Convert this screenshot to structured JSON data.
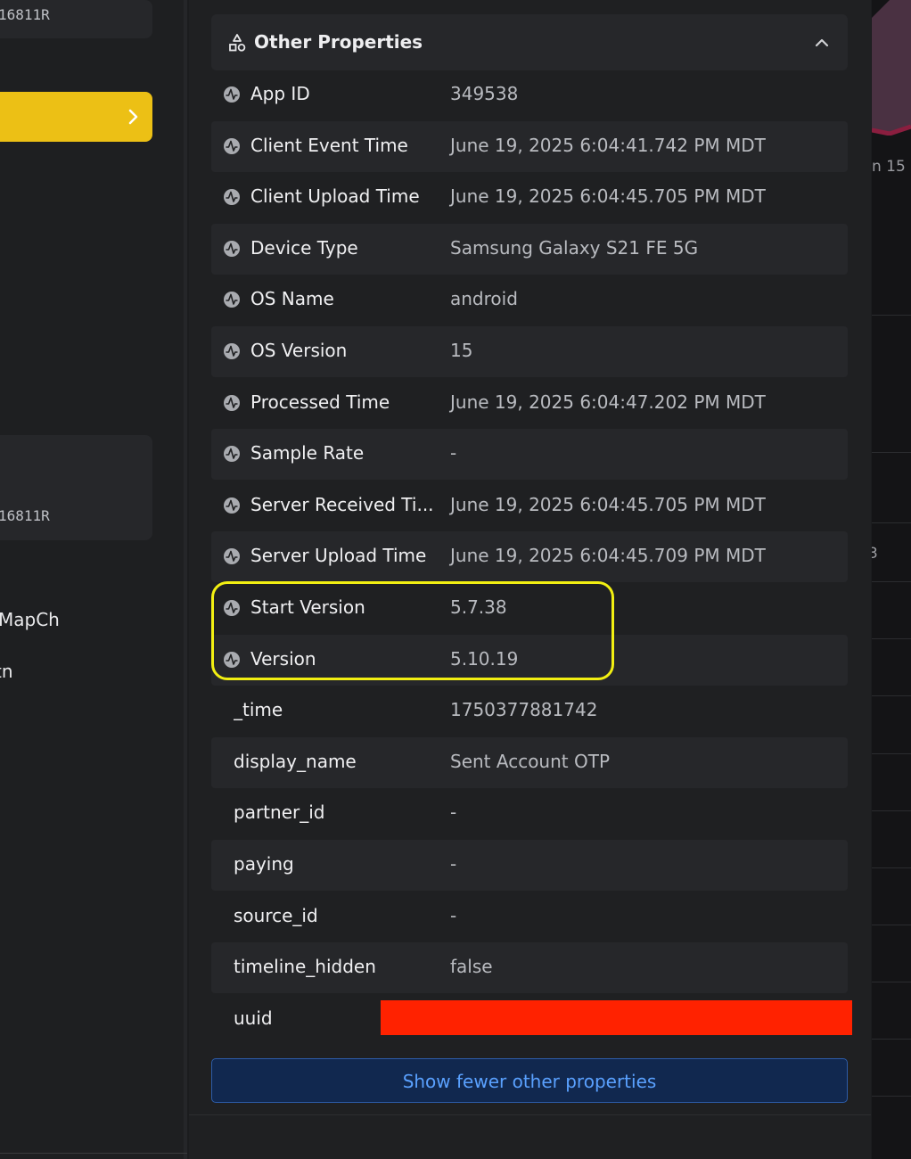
{
  "sidebar": {
    "id_top": "16811R",
    "id_bottom": "16811R",
    "text_a": "MapCh",
    "text_b": "tn",
    "active_item_color": "#ecc015"
  },
  "right_strip": {
    "label_top": "n 15",
    "label_mid": "3"
  },
  "section": {
    "title": "Other Properties",
    "icon": "shapes-icon",
    "collapse_icon": "chevron-up-icon"
  },
  "properties": [
    {
      "key": "App ID",
      "value": "349538"
    },
    {
      "key": "Client Event Time",
      "value": "June 19, 2025 6:04:41.742 PM MDT"
    },
    {
      "key": "Client Upload Time",
      "value": "June 19, 2025 6:04:45.705 PM MDT"
    },
    {
      "key": "Device Type",
      "value": "Samsung Galaxy S21 FE 5G"
    },
    {
      "key": "OS Name",
      "value": "android"
    },
    {
      "key": "OS Version",
      "value": "15"
    },
    {
      "key": "Processed Time",
      "value": "June 19, 2025 6:04:47.202 PM MDT"
    },
    {
      "key": "Sample Rate",
      "value": "-"
    },
    {
      "key": "Server Received Ti...",
      "value": "June 19, 2025 6:04:45.705 PM MDT"
    },
    {
      "key": "Server Upload Time",
      "value": "June 19, 2025 6:04:45.709 PM MDT"
    },
    {
      "key": "Start Version",
      "value": "5.7.38"
    },
    {
      "key": "Version",
      "value": "5.10.19"
    },
    {
      "key": "_time",
      "value": "1750377881742"
    },
    {
      "key": "display_name",
      "value": "Sent Account OTP"
    },
    {
      "key": "partner_id",
      "value": "-"
    },
    {
      "key": "paying",
      "value": "-"
    },
    {
      "key": "source_id",
      "value": "-"
    },
    {
      "key": "timeline_hidden",
      "value": "false"
    },
    {
      "key": "uuid",
      "value": ""
    }
  ],
  "show_fewer_label": "Show fewer other properties",
  "colors": {
    "highlight": "#f2ef12",
    "redaction": "#ff2200",
    "link": "#5aa1ff"
  }
}
